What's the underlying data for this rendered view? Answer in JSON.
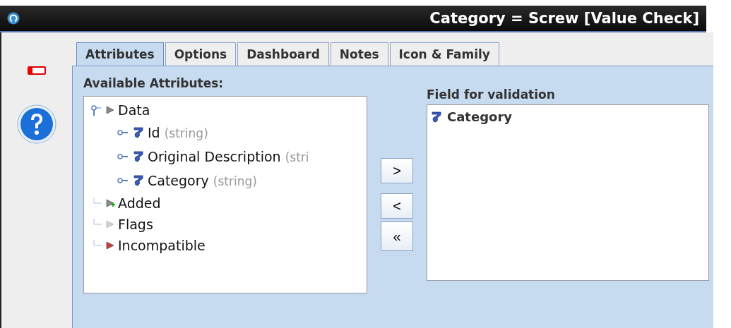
{
  "window": {
    "title": "Category = Screw [Value Check]"
  },
  "tabs": [
    {
      "label": "Attributes",
      "selected": true
    },
    {
      "label": "Options",
      "selected": false
    },
    {
      "label": "Dashboard",
      "selected": false
    },
    {
      "label": "Notes",
      "selected": false
    },
    {
      "label": "Icon & Family",
      "selected": false
    }
  ],
  "available": {
    "label": "Available Attributes:",
    "tree": [
      {
        "label": "Data",
        "kind": "data",
        "expanded": true,
        "children": [
          {
            "label": "Id",
            "type": "(string)"
          },
          {
            "label": "Original Description",
            "type": "(stri"
          },
          {
            "label": "Category",
            "type": "(string)"
          }
        ]
      },
      {
        "label": "Added",
        "kind": "added",
        "expanded": false
      },
      {
        "label": "Flags",
        "kind": "flags",
        "expanded": false
      },
      {
        "label": "Incompatible",
        "kind": "incompatible",
        "expanded": false
      }
    ]
  },
  "move_buttons": [
    ">",
    "<",
    "«"
  ],
  "validation": {
    "label": "Field for validation",
    "items": [
      "Category"
    ]
  }
}
